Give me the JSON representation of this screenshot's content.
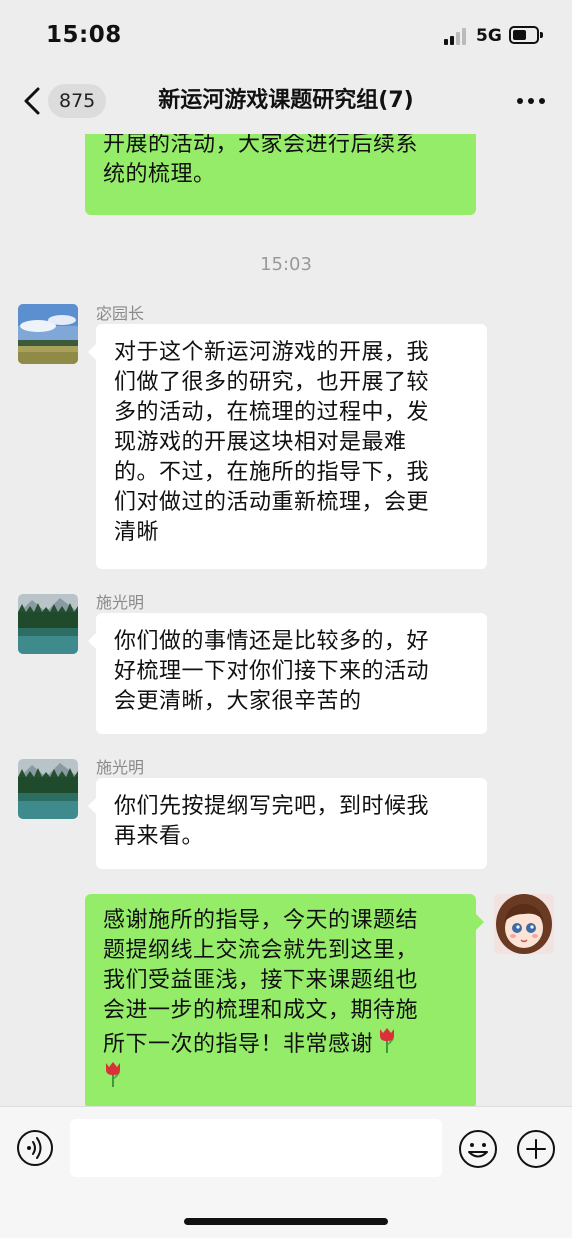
{
  "status_bar": {
    "time": "15:08",
    "network": "5G"
  },
  "header": {
    "unread_count": "875",
    "title": "新运河游戏课题研究组(7)"
  },
  "messages": [
    {
      "type": "outgoing",
      "lines": [
        "开展的活动，大家会进行后续系",
        "统的梳理。"
      ]
    },
    {
      "type": "time",
      "text": "15:03"
    },
    {
      "type": "incoming",
      "sender": "宓园长",
      "lines": [
        "对于这个新运河游戏的开展，我",
        "们做了很多的研究，也开展了较",
        "多的活动，在梳理的过程中，发",
        "现游戏的开展这块相对是最难",
        "的。不过，在施所的指导下，我",
        "们对做过的活动重新梳理，会更",
        "清晰"
      ]
    },
    {
      "type": "incoming",
      "sender": "施光明",
      "lines": [
        "你们做的事情还是比较多的，好",
        "好梳理一下对你们接下来的活动",
        "会更清晰，大家很辛苦的"
      ]
    },
    {
      "type": "incoming",
      "sender": "施光明",
      "lines": [
        "你们先按提纲写完吧，到时候我",
        "再来看。"
      ]
    },
    {
      "type": "outgoing",
      "lines": [
        "感谢施所的指导，今天的课题结",
        "题提纲线上交流会就先到这里，",
        "我们受益匪浅，接下来课题组也",
        "会进一步的梳理和成文，期待施",
        "所下一次的指导！非常感谢"
      ]
    }
  ],
  "icons": {
    "back": "chevron-left-icon",
    "more": "ellipsis-icon",
    "voice": "voice-icon",
    "emoji": "emoji-icon",
    "plus": "plus-icon",
    "tulip": "tulip-emoji"
  },
  "colors": {
    "background": "#ededed",
    "outgoing_bubble": "#95ec69",
    "incoming_bubble": "#ffffff"
  }
}
